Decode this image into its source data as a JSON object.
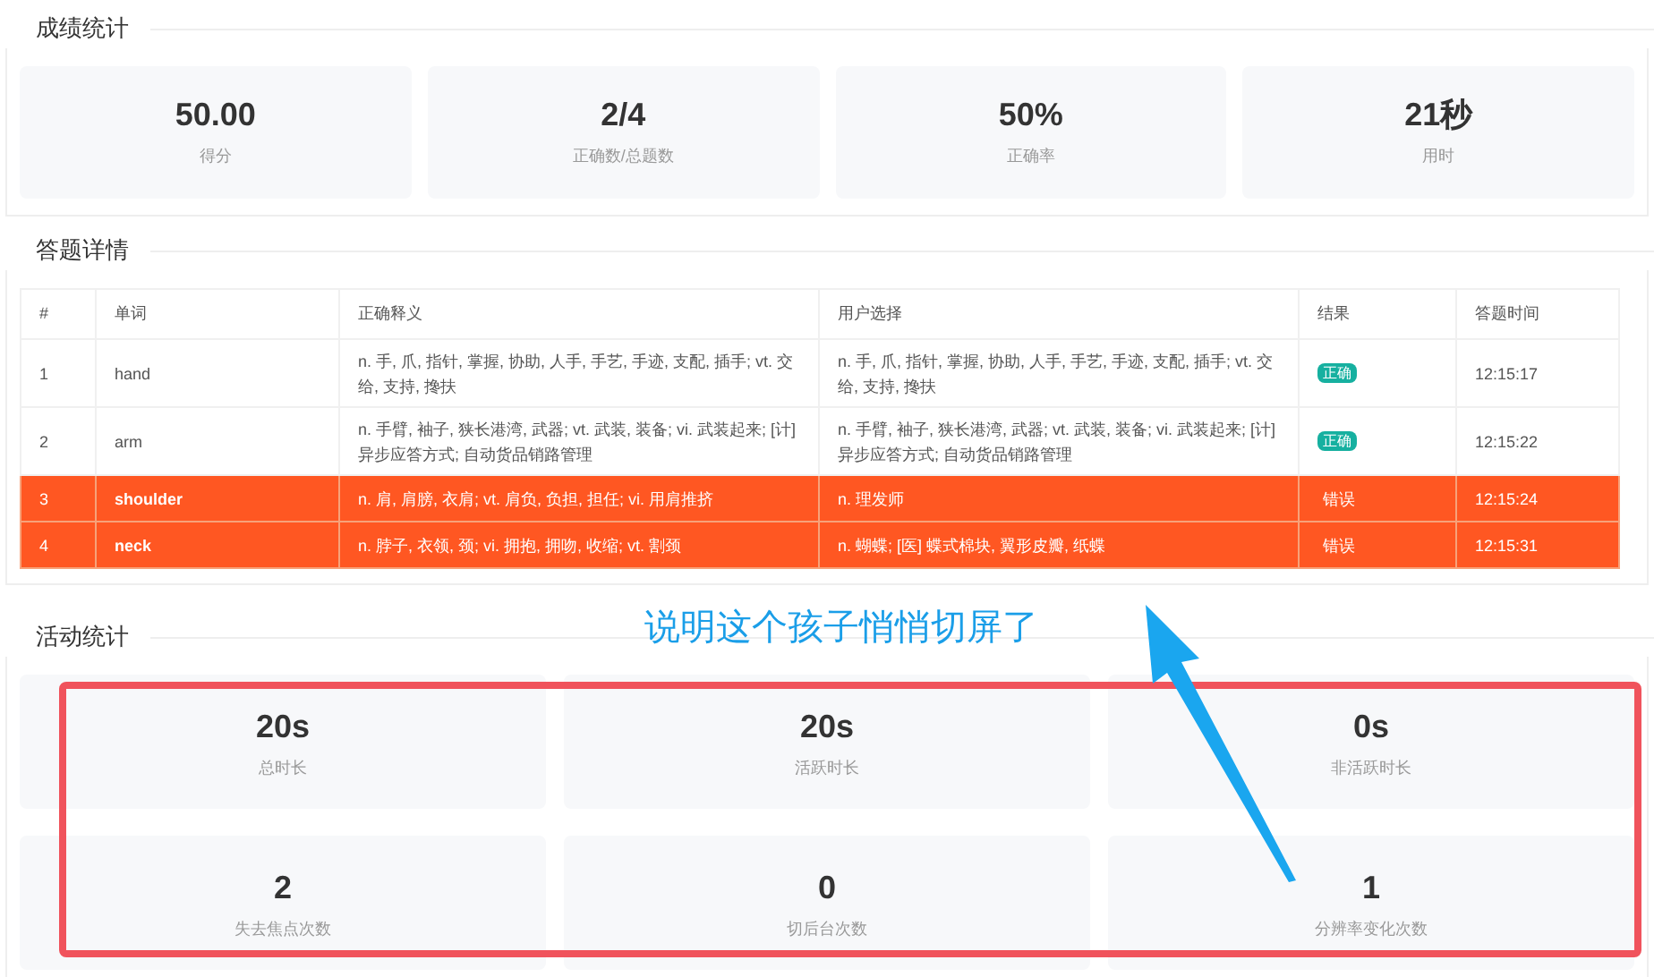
{
  "score_section": {
    "title": "成绩统计",
    "cards": [
      {
        "value": "50.00",
        "label": "得分"
      },
      {
        "value": "2/4",
        "label": "正确数/总题数"
      },
      {
        "value": "50%",
        "label": "正确率"
      },
      {
        "value": "21秒",
        "label": "用时"
      }
    ]
  },
  "detail_section": {
    "title": "答题详情",
    "table": {
      "columns": [
        "#",
        "单词",
        "正确释义",
        "用户选择",
        "结果",
        "答题时间"
      ],
      "rows": [
        {
          "index": "1",
          "word": "hand",
          "definition": "n. 手, 爪, 指针, 掌握, 协助, 人手, 手艺, 手迹, 支配, 插手; vt. 交给, 支持, 搀扶",
          "choice": "n. 手, 爪, 指针, 掌握, 协助, 人手, 手艺, 手迹, 支配, 插手; vt. 交给, 支持, 搀扶",
          "result": "正确",
          "correct": true,
          "time": "12:15:17"
        },
        {
          "index": "2",
          "word": "arm",
          "definition": "n. 手臂, 袖子, 狭长港湾, 武器; vt. 武装, 装备; vi. 武装起来; [计] 异步应答方式; 自动货品销路管理",
          "choice": "n. 手臂, 袖子, 狭长港湾, 武器; vt. 武装, 装备; vi. 武装起来; [计] 异步应答方式; 自动货品销路管理",
          "result": "正确",
          "correct": true,
          "time": "12:15:22"
        },
        {
          "index": "3",
          "word": "shoulder",
          "definition": "n. 肩, 肩膀, 衣肩; vt. 肩负, 负担, 担任; vi. 用肩推挤",
          "choice": "n. 理发师",
          "result": "错误",
          "correct": false,
          "time": "12:15:24"
        },
        {
          "index": "4",
          "word": "neck",
          "definition": "n. 脖子, 衣领, 颈; vi. 拥抱, 拥吻, 收缩; vt. 割颈",
          "choice": "n. 蝴蝶; [医] 蝶式棉块, 翼形皮瓣, 纸蝶",
          "result": "错误",
          "correct": false,
          "time": "12:15:31"
        }
      ]
    }
  },
  "activity_section": {
    "title": "活动统计",
    "cards": [
      {
        "value": "20s",
        "label": "总时长"
      },
      {
        "value": "20s",
        "label": "活跃时长"
      },
      {
        "value": "0s",
        "label": "非活跃时长"
      },
      {
        "value": "2",
        "label": "失去焦点次数"
      },
      {
        "value": "0",
        "label": "切后台次数"
      },
      {
        "value": "1",
        "label": "分辨率变化次数"
      }
    ]
  },
  "annotation": {
    "text": "说明这个孩子悄悄切屏了"
  }
}
